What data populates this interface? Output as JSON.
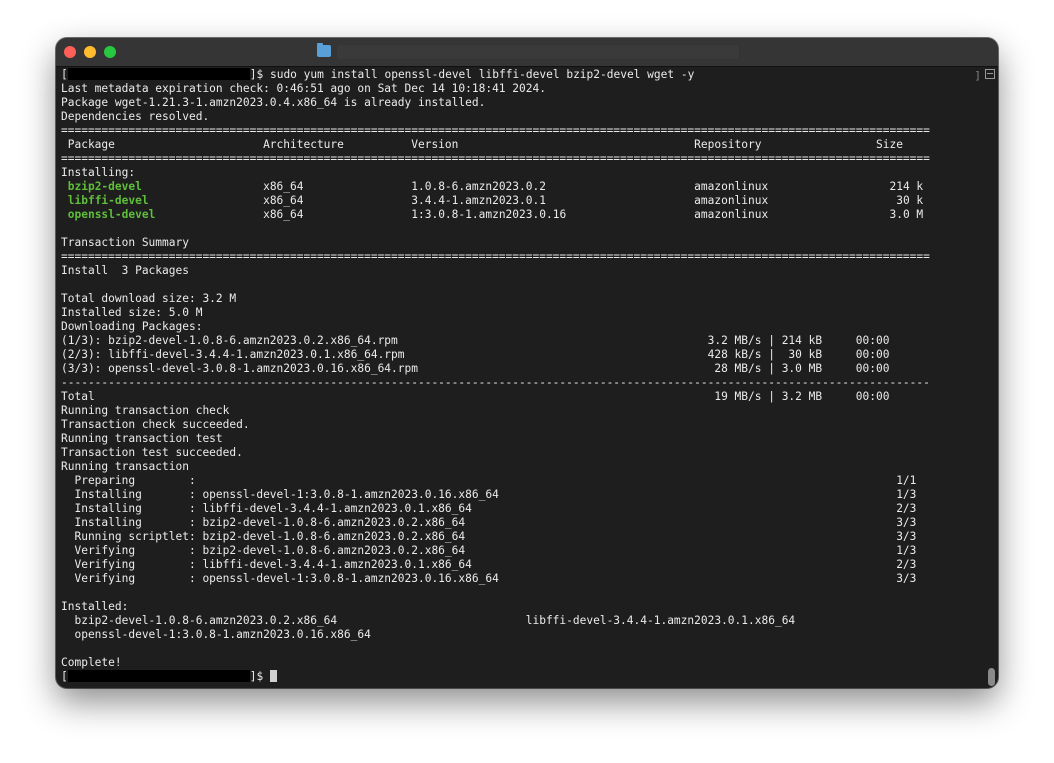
{
  "prompt": {
    "open_bracket": "[",
    "suffix": "]$ "
  },
  "command": "sudo yum install openssl-devel libffi-devel bzip2-devel wget -y",
  "pre_lines": [
    "Last metadata expiration check: 0:46:51 ago on Sat Dec 14 10:18:41 2024.",
    "Package wget-1.21.3-1.amzn2023.0.4.x86_64 is already installed.",
    "Dependencies resolved."
  ],
  "separator_double": "=================================================================================================================================",
  "separator_single": "---------------------------------------------------------------------------------------------------------------------------------",
  "table_header": {
    "package": "Package",
    "arch": "Architecture",
    "version": "Version",
    "repo": "Repository",
    "size": "Size"
  },
  "installing_label": "Installing:",
  "packages": [
    {
      "name": "bzip2-devel",
      "arch": "x86_64",
      "version": "1.0.8-6.amzn2023.0.2",
      "repo": "amazonlinux",
      "size": "214 k"
    },
    {
      "name": "libffi-devel",
      "arch": "x86_64",
      "version": "3.4.4-1.amzn2023.0.1",
      "repo": "amazonlinux",
      "size": "30 k"
    },
    {
      "name": "openssl-devel",
      "arch": "x86_64",
      "version": "1:3.0.8-1.amzn2023.0.16",
      "repo": "amazonlinux",
      "size": "3.0 M"
    }
  ],
  "transaction_summary_label": "Transaction Summary",
  "install_count_line": "Install  3 Packages",
  "size_lines": [
    "Total download size: 3.2 M",
    "Installed size: 5.0 M",
    "Downloading Packages:"
  ],
  "downloads": [
    {
      "file": "(1/3): bzip2-devel-1.0.8-6.amzn2023.0.2.x86_64.rpm",
      "rate": "3.2 MB/s",
      "size": "214 kB",
      "time": "00:00"
    },
    {
      "file": "(2/3): libffi-devel-3.4.4-1.amzn2023.0.1.x86_64.rpm",
      "rate": "428 kB/s",
      "size": "30 kB",
      "time": "00:00"
    },
    {
      "file": "(3/3): openssl-devel-3.0.8-1.amzn2023.0.16.x86_64.rpm",
      "rate": "28 MB/s",
      "size": "3.0 MB",
      "time": "00:00"
    }
  ],
  "total": {
    "label": "Total",
    "rate": "19 MB/s",
    "size": "3.2 MB",
    "time": "00:00"
  },
  "transaction_lines": [
    "Running transaction check",
    "Transaction check succeeded.",
    "Running transaction test",
    "Transaction test succeeded.",
    "Running transaction"
  ],
  "steps": [
    {
      "action": "Preparing",
      "target": "",
      "progress": "1/1"
    },
    {
      "action": "Installing",
      "target": "openssl-devel-1:3.0.8-1.amzn2023.0.16.x86_64",
      "progress": "1/3"
    },
    {
      "action": "Installing",
      "target": "libffi-devel-3.4.4-1.amzn2023.0.1.x86_64",
      "progress": "2/3"
    },
    {
      "action": "Installing",
      "target": "bzip2-devel-1.0.8-6.amzn2023.0.2.x86_64",
      "progress": "3/3"
    },
    {
      "action": "Running scriptlet",
      "target": "bzip2-devel-1.0.8-6.amzn2023.0.2.x86_64",
      "progress": "3/3"
    },
    {
      "action": "Verifying",
      "target": "bzip2-devel-1.0.8-6.amzn2023.0.2.x86_64",
      "progress": "1/3"
    },
    {
      "action": "Verifying",
      "target": "libffi-devel-3.4.4-1.amzn2023.0.1.x86_64",
      "progress": "2/3"
    },
    {
      "action": "Verifying",
      "target": "openssl-devel-1:3.0.8-1.amzn2023.0.16.x86_64",
      "progress": "3/3"
    }
  ],
  "installed_label": "Installed:",
  "installed": [
    "bzip2-devel-1.0.8-6.amzn2023.0.2.x86_64",
    "libffi-devel-3.4.4-1.amzn2023.0.1.x86_64",
    "openssl-devel-1:3.0.8-1.amzn2023.0.16.x86_64"
  ],
  "complete": "Complete!",
  "colors": {
    "terminal_bg": "#1e1e1e",
    "text": "#ebebeb",
    "package_green": "#5fbf3a"
  }
}
